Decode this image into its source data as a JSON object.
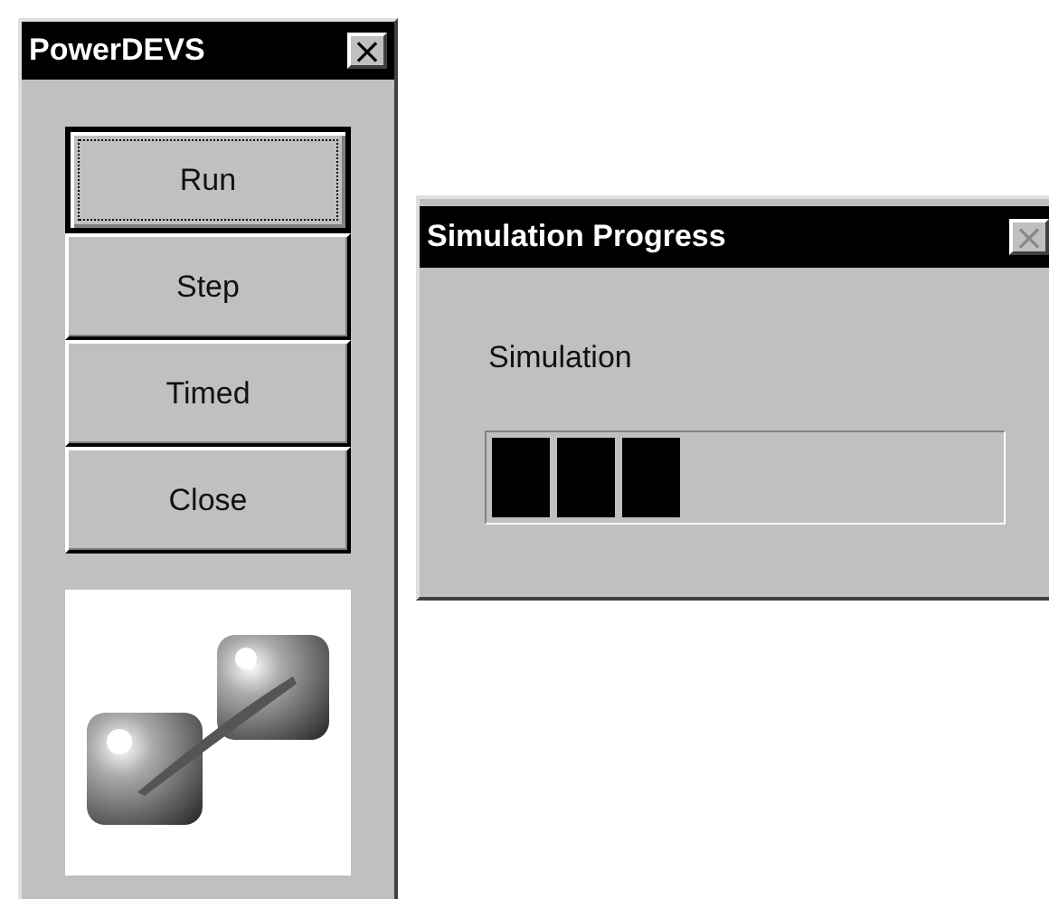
{
  "main_window": {
    "title": "PowerDEVS",
    "close_label": "×",
    "buttons": [
      {
        "label": "Run",
        "focused": true
      },
      {
        "label": "Step",
        "focused": false
      },
      {
        "label": "Timed",
        "focused": false
      },
      {
        "label": "Close",
        "focused": false
      }
    ]
  },
  "progress_dialog": {
    "title": "Simulation Progress",
    "close_label": "×",
    "close_disabled": true,
    "message": "Simulation",
    "level": 0.375
  }
}
